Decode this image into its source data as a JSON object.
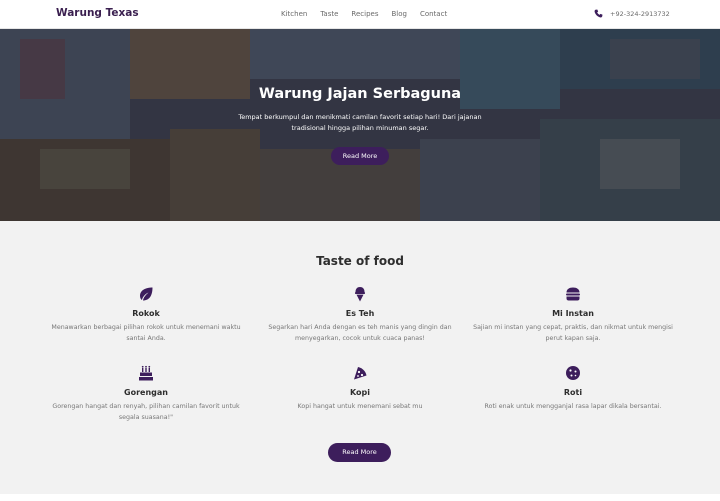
{
  "navbar": {
    "brand": "Warung Texas",
    "links": [
      "Kitchen",
      "Taste",
      "Recipes",
      "Blog",
      "Contact"
    ],
    "phone": "+92-324-2913732",
    "phone_icon": "phone-icon"
  },
  "hero": {
    "title": "Warung Jajan Serbaguna",
    "subtitle": "Tempat berkumpul dan menikmati camilan favorit setiap hari! Dari jajanan tradisional hingga pilihan minuman segar.",
    "button": "Read More"
  },
  "section": {
    "title": "Taste of food",
    "features": [
      {
        "icon": "leaf-icon",
        "title": "Rokok",
        "desc": "Menawarkan berbagai pilihan rokok untuk menemani waktu santai Anda."
      },
      {
        "icon": "ice-cream-icon",
        "title": "Es Teh",
        "desc": "Segarkan hari Anda dengan es teh manis yang dingin dan menyegarkan, cocok untuk cuaca panas!"
      },
      {
        "icon": "hamburger-icon",
        "title": "Mi Instan",
        "desc": "Sajian mi instan yang cepat, praktis, dan nikmat untuk mengisi perut kapan saja."
      },
      {
        "icon": "birthday-cake-icon",
        "title": "Gorengan",
        "desc": "Gorengan hangat dan renyah, pilihan camilan favorit untuk segala suasana!\""
      },
      {
        "icon": "pizza-slice-icon",
        "title": "Kopi",
        "desc": "Kopi hangat untuk menemani sebat mu"
      },
      {
        "icon": "cookie-icon",
        "title": "Roti",
        "desc": "Roti enak untuk mengganjal rasa lapar dikala bersantai."
      }
    ],
    "button": "Read More"
  },
  "colors": {
    "accent": "#3d1e5c",
    "brand": "#3a1f4f"
  }
}
